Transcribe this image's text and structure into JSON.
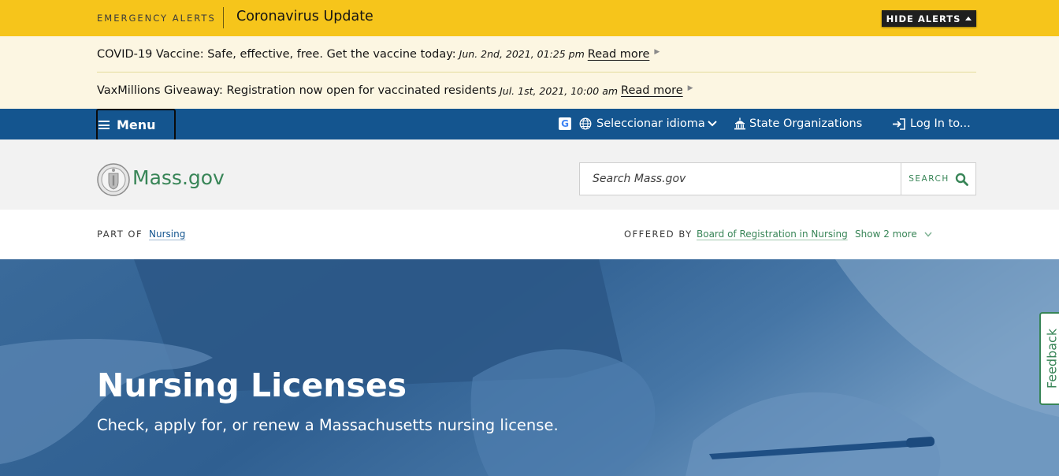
{
  "alerts": {
    "kicker": "EMERGENCY ALERTS",
    "title": "Coronavirus Update",
    "hide_label": "HIDE ALERTS",
    "items": [
      {
        "text": "COVID-19 Vaccine: Safe, effective, free. Get the vaccine today:",
        "date": "Jun. 2nd, 2021, 01:25 pm",
        "link": "Read more"
      },
      {
        "text": "VaxMillions Giveaway: Registration now open for vaccinated residents",
        "date": "Jul. 1st, 2021, 10:00 am",
        "link": "Read more"
      }
    ]
  },
  "utility_nav": {
    "menu_label": "Menu",
    "google_badge": "G",
    "language_label": "Seleccionar idioma",
    "state_orgs_label": "State Organizations",
    "login_label": "Log In to..."
  },
  "header": {
    "brand": "Mass.gov",
    "search_placeholder": "Search Mass.gov",
    "search_button": "SEARCH"
  },
  "relationship": {
    "part_of_label": "PART OF",
    "part_of_link": "Nursing",
    "offered_by_label": "OFFERED BY",
    "offered_by_link": "Board of Registration in Nursing",
    "show_more": "Show 2 more"
  },
  "hero": {
    "title": "Nursing Licenses",
    "subtitle": "Check, apply for, or renew a Massachusetts nursing license."
  },
  "feedback": {
    "label": "Feedback"
  },
  "icons": {
    "hamburger": "menu-icon",
    "google": "google-translate-icon",
    "globe": "globe-icon",
    "capitol": "state-building-icon",
    "login": "login-icon",
    "search": "search-icon",
    "seal": "state-seal-icon"
  },
  "colors": {
    "alert_yellow": "#f6c51b",
    "alert_cream": "#fcf6e2",
    "nav_blue": "#14558f",
    "brand_green": "#388557",
    "header_gray": "#f2f2f2"
  }
}
